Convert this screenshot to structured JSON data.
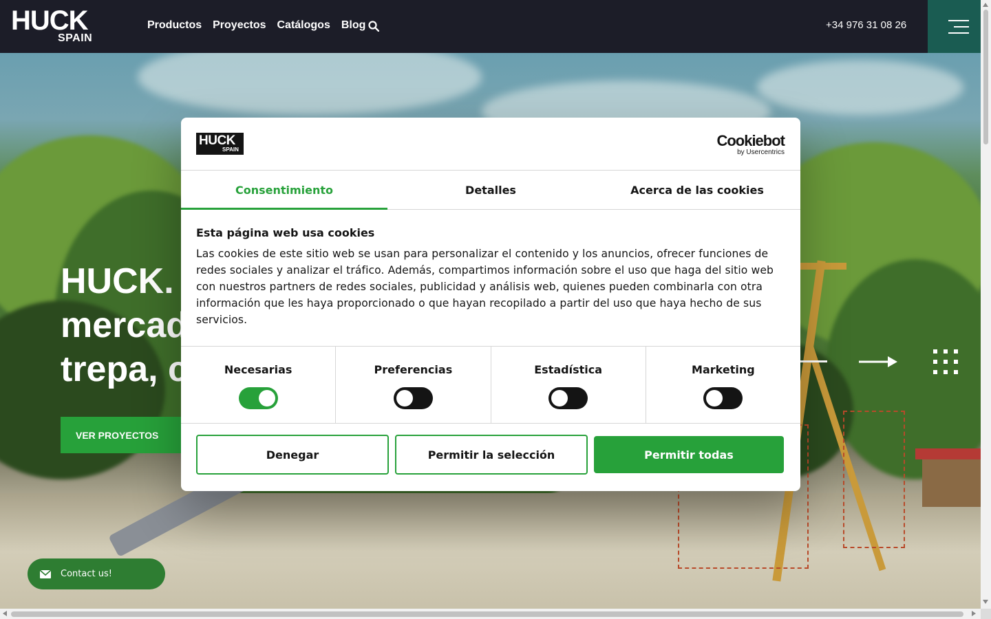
{
  "header": {
    "logo_main": "HUCK",
    "logo_sub": "SPAIN",
    "nav": [
      "Productos",
      "Proyectos",
      "Catálogos",
      "Blog"
    ],
    "phone": "+34 976 31 08 26",
    "search_icon": "search-icon",
    "menu_icon": "hamburger-menu-icon"
  },
  "hero": {
    "title_lines": [
      "HUCK. ",
      "mercad",
      "trepa, c"
    ],
    "cta_label": "VER PROYECTOS",
    "prev_icon": "arrow-left-icon",
    "next_icon": "arrow-right-icon",
    "grid_icon": "grid-dots-icon"
  },
  "contact": {
    "label": "Contact us!",
    "icon": "envelope-icon"
  },
  "dialog": {
    "logo_main": "HUCK",
    "logo_sub": "SPAIN",
    "provider": "Cookiebot",
    "provider_sub": "by Usercentrics",
    "tabs": [
      "Consentimiento",
      "Detalles",
      "Acerca de las cookies"
    ],
    "active_tab": "Consentimiento",
    "title": "Esta página web usa cookies",
    "text": "Las cookies de este sitio web se usan para personalizar el contenido y los anuncios, ofrecer funciones de redes sociales y analizar el tráfico. Además, compartimos información sobre el uso que haga del sitio web con nuestros partners de redes sociales, publicidad y análisis web, quienes pueden combinarla con otra información que les haya proporcionado o que hayan recopilado a partir del uso que haya hecho de sus servicios.",
    "categories": [
      {
        "label": "Necesarias",
        "enabled": true
      },
      {
        "label": "Preferencias",
        "enabled": false
      },
      {
        "label": "Estadística",
        "enabled": false
      },
      {
        "label": "Marketing",
        "enabled": false
      }
    ],
    "buttons": {
      "deny": "Denegar",
      "allow_selection": "Permitir la selección",
      "allow_all": "Permitir todas"
    }
  },
  "colors": {
    "brand_dark": "#1c1d28",
    "accent_green": "#27a13a",
    "menu_teal": "#1a5c52"
  }
}
